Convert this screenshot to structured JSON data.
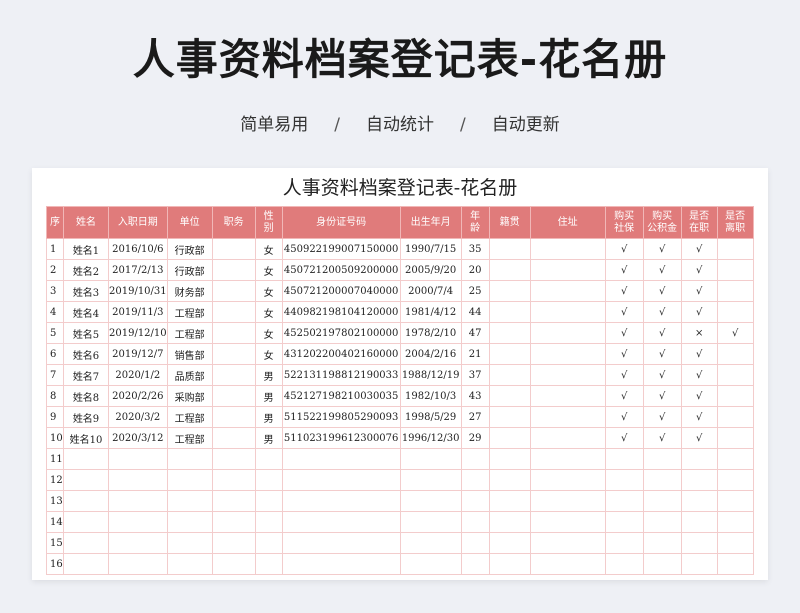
{
  "title": "人事资料档案登记表-花名册",
  "taglines": [
    "简单易用",
    "自动统计",
    "自动更新"
  ],
  "separator": "/",
  "sheet": {
    "title": "人事资料档案登记表-花名册",
    "headers": [
      "序",
      "姓名",
      "入职日期",
      "单位",
      "职务",
      "性别",
      "身份证号码",
      "出生年月",
      "年龄",
      "籍贯",
      "住址",
      "购买社保",
      "购买公积金",
      "是否在职",
      "是否离职"
    ],
    "rows": [
      [
        "1",
        "姓名1",
        "2016/10/6",
        "行政部",
        "",
        "女",
        "450922199007150000",
        "1990/7/15",
        "35",
        "",
        "",
        "√",
        "√",
        "√",
        ""
      ],
      [
        "2",
        "姓名2",
        "2017/2/13",
        "行政部",
        "",
        "女",
        "450721200509200000",
        "2005/9/20",
        "20",
        "",
        "",
        "√",
        "√",
        "√",
        ""
      ],
      [
        "3",
        "姓名3",
        "2019/10/31",
        "财务部",
        "",
        "女",
        "450721200007040000",
        "2000/7/4",
        "25",
        "",
        "",
        "√",
        "√",
        "√",
        ""
      ],
      [
        "4",
        "姓名4",
        "2019/11/3",
        "工程部",
        "",
        "女",
        "440982198104120000",
        "1981/4/12",
        "44",
        "",
        "",
        "√",
        "√",
        "√",
        ""
      ],
      [
        "5",
        "姓名5",
        "2019/12/10",
        "工程部",
        "",
        "女",
        "452502197802100000",
        "1978/2/10",
        "47",
        "",
        "",
        "√",
        "√",
        "×",
        "√"
      ],
      [
        "6",
        "姓名6",
        "2019/12/7",
        "销售部",
        "",
        "女",
        "431202200402160000",
        "2004/2/16",
        "21",
        "",
        "",
        "√",
        "√",
        "√",
        ""
      ],
      [
        "7",
        "姓名7",
        "2020/1/2",
        "品质部",
        "",
        "男",
        "522131198812190033",
        "1988/12/19",
        "37",
        "",
        "",
        "√",
        "√",
        "√",
        ""
      ],
      [
        "8",
        "姓名8",
        "2020/2/26",
        "采购部",
        "",
        "男",
        "452127198210030035",
        "1982/10/3",
        "43",
        "",
        "",
        "√",
        "√",
        "√",
        ""
      ],
      [
        "9",
        "姓名9",
        "2020/3/2",
        "工程部",
        "",
        "男",
        "511522199805290093",
        "1998/5/29",
        "27",
        "",
        "",
        "√",
        "√",
        "√",
        ""
      ],
      [
        "10",
        "姓名10",
        "2020/3/12",
        "工程部",
        "",
        "男",
        "511023199612300076",
        "1996/12/30",
        "29",
        "",
        "",
        "√",
        "√",
        "√",
        ""
      ],
      [
        "11",
        "",
        "",
        "",
        "",
        "",
        "",
        "",
        "",
        "",
        "",
        "",
        "",
        "",
        ""
      ],
      [
        "12",
        "",
        "",
        "",
        "",
        "",
        "",
        "",
        "",
        "",
        "",
        "",
        "",
        "",
        ""
      ],
      [
        "13",
        "",
        "",
        "",
        "",
        "",
        "",
        "",
        "",
        "",
        "",
        "",
        "",
        "",
        ""
      ],
      [
        "14",
        "",
        "",
        "",
        "",
        "",
        "",
        "",
        "",
        "",
        "",
        "",
        "",
        "",
        ""
      ],
      [
        "15",
        "",
        "",
        "",
        "",
        "",
        "",
        "",
        "",
        "",
        "",
        "",
        "",
        "",
        ""
      ],
      [
        "16",
        "",
        "",
        "",
        "",
        "",
        "",
        "",
        "",
        "",
        "",
        "",
        "",
        "",
        ""
      ]
    ]
  }
}
